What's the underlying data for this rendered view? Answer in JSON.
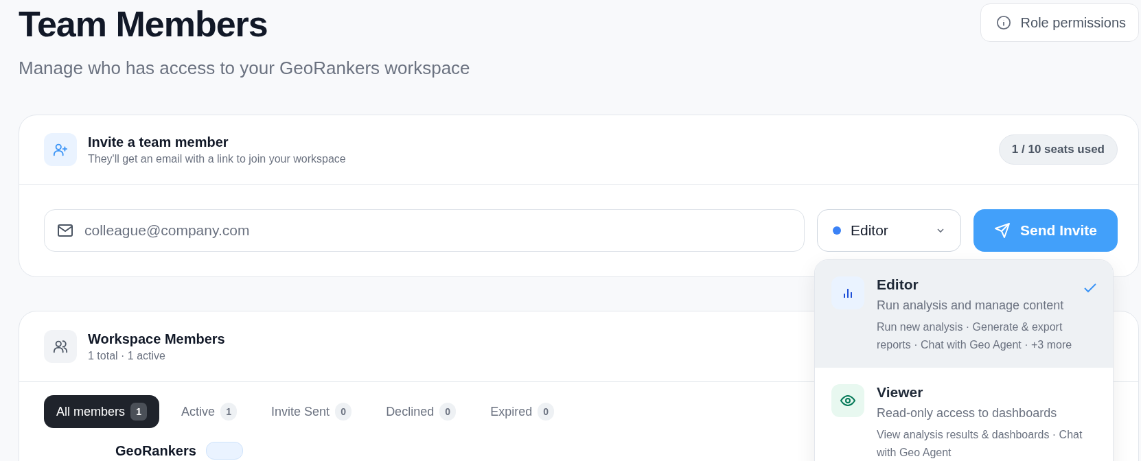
{
  "page": {
    "title": "Team Members",
    "subtitle": "Manage who has access to your GeoRankers workspace"
  },
  "role_permissions_button": {
    "label": "Role permissions"
  },
  "invite_card": {
    "title": "Invite a team member",
    "subtitle": "They'll get an email with a link to join your workspace",
    "seats_badge": "1 / 10 seats used",
    "email_field": {
      "placeholder": "colleague@company.com"
    },
    "role_select": {
      "value": "Editor",
      "expanded": true
    },
    "send_button": {
      "label": "Send Invite"
    }
  },
  "role_menu": {
    "options": [
      {
        "kind": "editor",
        "title": "Editor",
        "description": "Run analysis and manage content",
        "permissions": "Run new analysis · Generate & export reports · Chat with Geo Agent · +3 more",
        "selected": true
      },
      {
        "kind": "viewer",
        "title": "Viewer",
        "description": "Read-only access to dashboards",
        "permissions": "View analysis results & dashboards · Chat with Geo Agent",
        "selected": false
      }
    ]
  },
  "members_card": {
    "title": "Workspace Members",
    "summary": "1 total · 1 active",
    "filters": [
      {
        "label": "All members",
        "count": "1",
        "selected": true
      },
      {
        "label": "Active",
        "count": "1",
        "selected": false
      },
      {
        "label": "Invite Sent",
        "count": "0",
        "selected": false
      },
      {
        "label": "Declined",
        "count": "0",
        "selected": false
      },
      {
        "label": "Expired",
        "count": "0",
        "selected": false
      }
    ],
    "members": [
      {
        "name": "GeoRankers"
      }
    ]
  }
}
